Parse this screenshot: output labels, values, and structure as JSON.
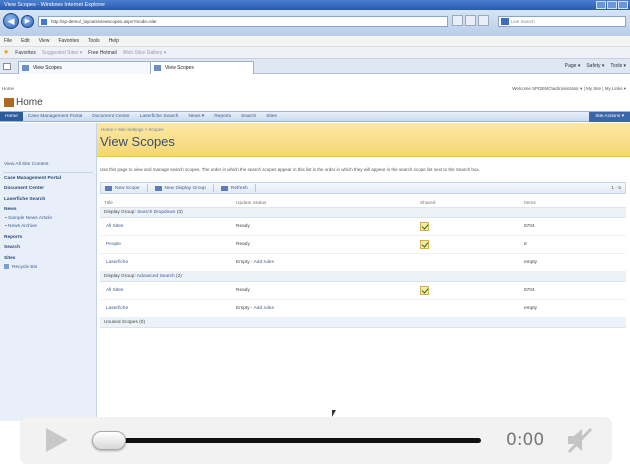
{
  "window": {
    "title": "View Scopes - Windows Internet Explorer"
  },
  "browser": {
    "address": "http://sp-demo/_layouts/viewscopes.aspx?mode=site",
    "search_placeholder": "Live Search",
    "menu": [
      "File",
      "Edit",
      "View",
      "Favorites",
      "Tools",
      "Help"
    ],
    "favorites_label": "Favorites",
    "favorites_items": [
      "Suggested Sites ▾",
      "Free Hotmail",
      "Web Slice Gallery ▾"
    ],
    "tabs": [
      {
        "label": "View Scopes"
      },
      {
        "label": "View Scopes"
      }
    ],
    "command_bar": [
      "Page ▾",
      "Safety ▾",
      "Tools ▾"
    ]
  },
  "sharepoint": {
    "site_label": "Home",
    "welcome": "Welcome SPDEMO\\administrator ▾ | My Site | My Links ▾",
    "site_title": "Home",
    "topnav": [
      "Home",
      "Case Management Portal",
      "Document Center",
      "Laserfiche Search",
      "News ▾",
      "Reports",
      "Search",
      "Sites"
    ],
    "site_actions": "Site Actions ▾",
    "quick_launch": {
      "view_all": "View All Site Content",
      "items": [
        {
          "label": "Case Management Portal",
          "kind": "heading"
        },
        {
          "label": "Document Center",
          "kind": "heading"
        },
        {
          "label": "Laserfiche Search",
          "kind": "heading"
        },
        {
          "label": "News",
          "kind": "heading"
        },
        {
          "label": "Sample News Article",
          "kind": "sub"
        },
        {
          "label": "News Archive",
          "kind": "sub"
        },
        {
          "label": "Reports",
          "kind": "heading"
        },
        {
          "label": "Search",
          "kind": "heading"
        },
        {
          "label": "Sites",
          "kind": "heading"
        },
        {
          "label": "Recycle Bin",
          "kind": "bin"
        }
      ]
    },
    "breadcrumb": "Home > Site Settings > Scopes",
    "page_title": "View Scopes",
    "description": "Use this page to view and manage search scopes. The order in which the search scopes appear in this list is the order in which they will appear in the search scope list next to the Search box.",
    "toolbar": {
      "new_scope": "New Scope",
      "new_display_group": "New Display Group",
      "refresh": "Refresh",
      "paging": "1 - 5"
    },
    "table": {
      "columns": [
        "Title",
        "Update Status",
        "Shared",
        "Items"
      ],
      "groups": [
        {
          "label": "Display Group: ",
          "link": "Search Dropdown",
          "count": " (3)",
          "rows": [
            {
              "title": "All Sites",
              "status": "Ready",
              "add_rules": "",
              "shared": true,
              "items": "8704"
            },
            {
              "title": "People",
              "status": "Ready",
              "add_rules": "",
              "shared": true,
              "items": "8"
            },
            {
              "title": "Laserfiche",
              "status": "Empty - ",
              "add_rules": "Add rules",
              "shared": false,
              "items": "empty"
            }
          ]
        },
        {
          "label": "Display Group: ",
          "link": "Advanced Search",
          "count": " (2)",
          "rows": [
            {
              "title": "All Sites",
              "status": "Ready",
              "add_rules": "",
              "shared": true,
              "items": "8704"
            },
            {
              "title": "Laserfiche",
              "status": "Empty - ",
              "add_rules": "Add rules",
              "shared": false,
              "items": "empty"
            }
          ]
        }
      ],
      "unused": "Unused Scopes (0)"
    }
  },
  "video": {
    "time": "0:00",
    "progress": 0
  },
  "colors": {
    "title_band": "#f6d675",
    "nav_accent": "#2d5a9a",
    "link": "#3c5c8c"
  }
}
